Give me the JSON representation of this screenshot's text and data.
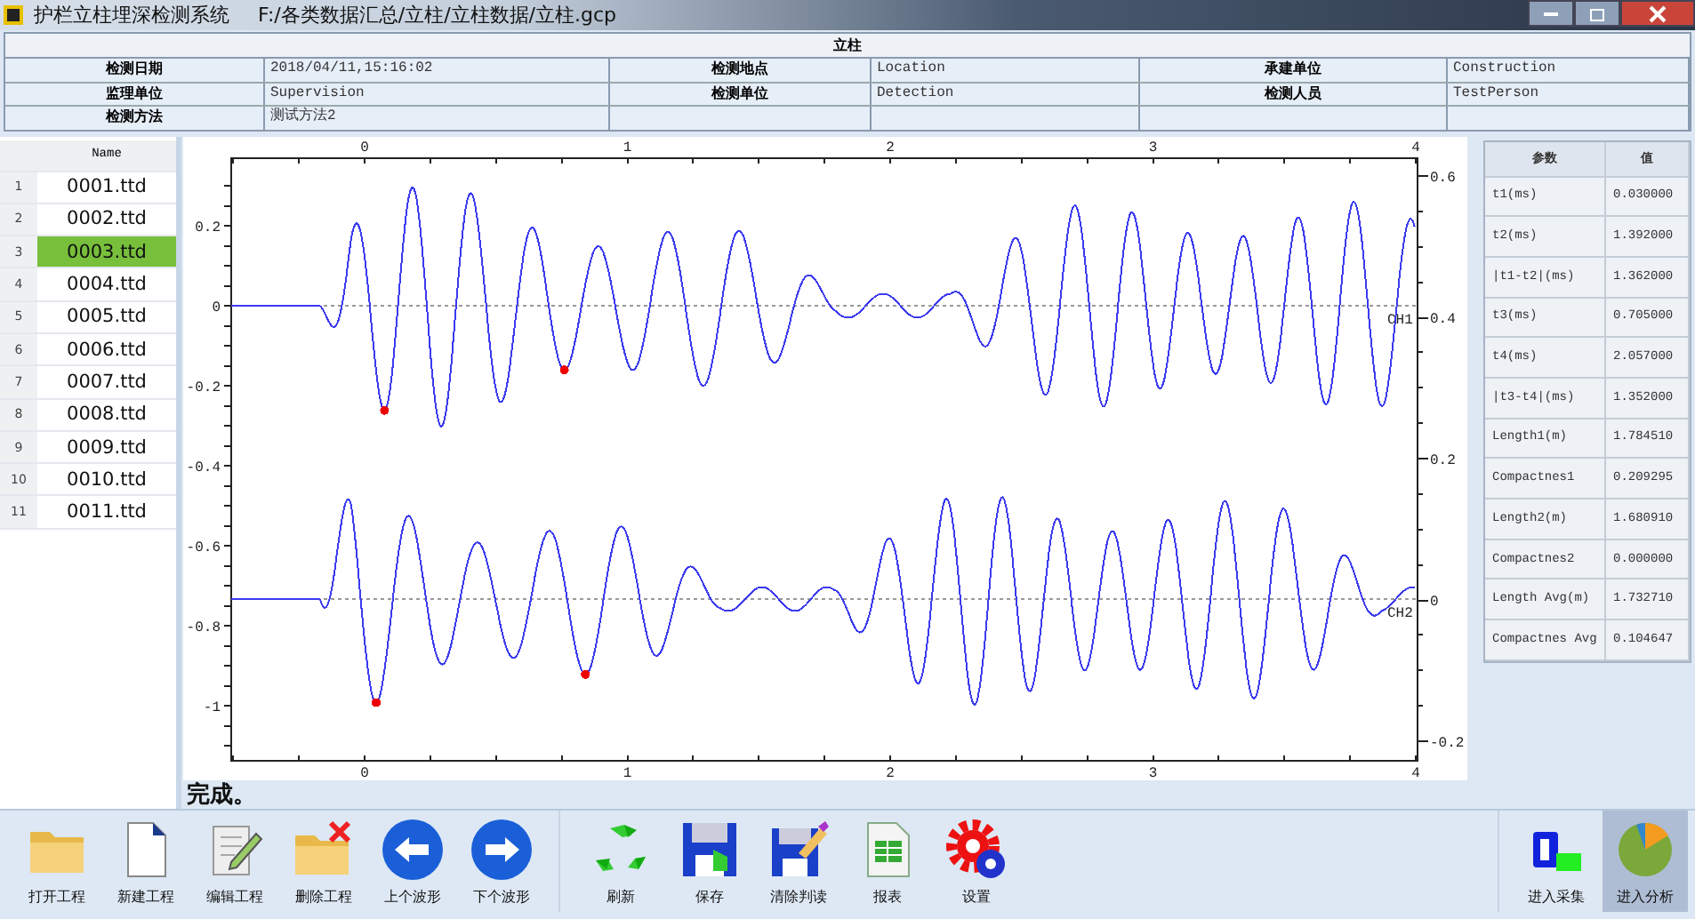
{
  "window": {
    "title": "护栏立柱埋深检测系统",
    "path": "F:/各类数据汇总/立柱/立柱数据/立柱.gcp"
  },
  "info_table": {
    "title": "立柱",
    "rows": [
      [
        {
          "label": "检测日期",
          "value": "2018/04/11,15:16:02"
        },
        {
          "label": "检测地点",
          "value": "Location"
        },
        {
          "label": "承建单位",
          "value": "Construction"
        }
      ],
      [
        {
          "label": "监理单位",
          "value": "Supervision"
        },
        {
          "label": "检测单位",
          "value": "Detection"
        },
        {
          "label": "检测人员",
          "value": "TestPerson"
        }
      ],
      [
        {
          "label": "检测方法",
          "value": "测试方法2"
        }
      ]
    ]
  },
  "file_list": {
    "column": "Name",
    "items": [
      {
        "number": "1",
        "name": "0001.ttd",
        "selected": false
      },
      {
        "number": "2",
        "name": "0002.ttd",
        "selected": false
      },
      {
        "number": "3",
        "name": "0003.ttd",
        "selected": true
      },
      {
        "number": "4",
        "name": "0004.ttd",
        "selected": false
      },
      {
        "number": "5",
        "name": "0005.ttd",
        "selected": false
      },
      {
        "number": "6",
        "name": "0006.ttd",
        "selected": false
      },
      {
        "number": "7",
        "name": "0007.ttd",
        "selected": false
      },
      {
        "number": "8",
        "name": "0008.ttd",
        "selected": false
      },
      {
        "number": "9",
        "name": "0009.ttd",
        "selected": false
      },
      {
        "number": "10",
        "name": "0010.ttd",
        "selected": false
      },
      {
        "number": "11",
        "name": "0011.ttd",
        "selected": false
      }
    ]
  },
  "waveform": {
    "top_ticks": [
      "0",
      "1",
      "2",
      "3",
      "4"
    ],
    "bottom_ticks": [
      "0",
      "1",
      "2",
      "3",
      "4"
    ],
    "left_ticks": [
      "0.2",
      "0",
      "-0.2",
      "-0.4",
      "-0.6",
      "-0.8",
      "-1"
    ],
    "right_ticks": [
      "0.6",
      "0.4",
      "0.2",
      "0",
      "-0.2"
    ],
    "channel_labels": [
      "CH1",
      "CH2"
    ]
  },
  "status": "完成。",
  "params": {
    "columns": [
      "参数",
      "值"
    ],
    "rows": [
      [
        "t1(ms)",
        "0.030000"
      ],
      [
        "t2(ms)",
        "1.392000"
      ],
      [
        "|t1-t2|(ms)",
        "1.362000"
      ],
      [
        "t3(ms)",
        "0.705000"
      ],
      [
        "t4(ms)",
        "2.057000"
      ],
      [
        "|t3-t4|(ms)",
        "1.352000"
      ],
      [
        "Length1(m)",
        "1.784510"
      ],
      [
        "Compactnes1",
        "0.209295"
      ],
      [
        "Length2(m)",
        "1.680910"
      ],
      [
        "Compactnes2",
        "0.000000"
      ],
      [
        "Length Avg(m)",
        "1.732710"
      ],
      [
        "Compactnes Avg",
        "0.104647"
      ]
    ]
  },
  "toolbar": {
    "groups": [
      [
        {
          "kind": "open",
          "label": "打开工程",
          "selected": false
        },
        {
          "kind": "new",
          "label": "新建工程",
          "selected": false
        },
        {
          "kind": "edit",
          "label": "编辑工程",
          "selected": false
        },
        {
          "kind": "delete",
          "label": "删除工程",
          "selected": false
        },
        {
          "kind": "prev",
          "label": "上个波形",
          "selected": false
        },
        {
          "kind": "next",
          "label": "下个波形",
          "selected": false
        }
      ],
      [
        {
          "kind": "refresh",
          "label": "刷新",
          "selected": false
        },
        {
          "kind": "save",
          "label": "保存",
          "selected": false
        },
        {
          "kind": "clear",
          "label": "清除判读",
          "selected": false
        },
        {
          "kind": "report",
          "label": "报表",
          "selected": false
        },
        {
          "kind": "settings",
          "label": "设置",
          "selected": false
        }
      ],
      [
        {
          "kind": "daq",
          "label": "进入采集",
          "selected": false
        },
        {
          "kind": "analysis",
          "label": "进入分析",
          "selected": true
        }
      ]
    ]
  }
}
